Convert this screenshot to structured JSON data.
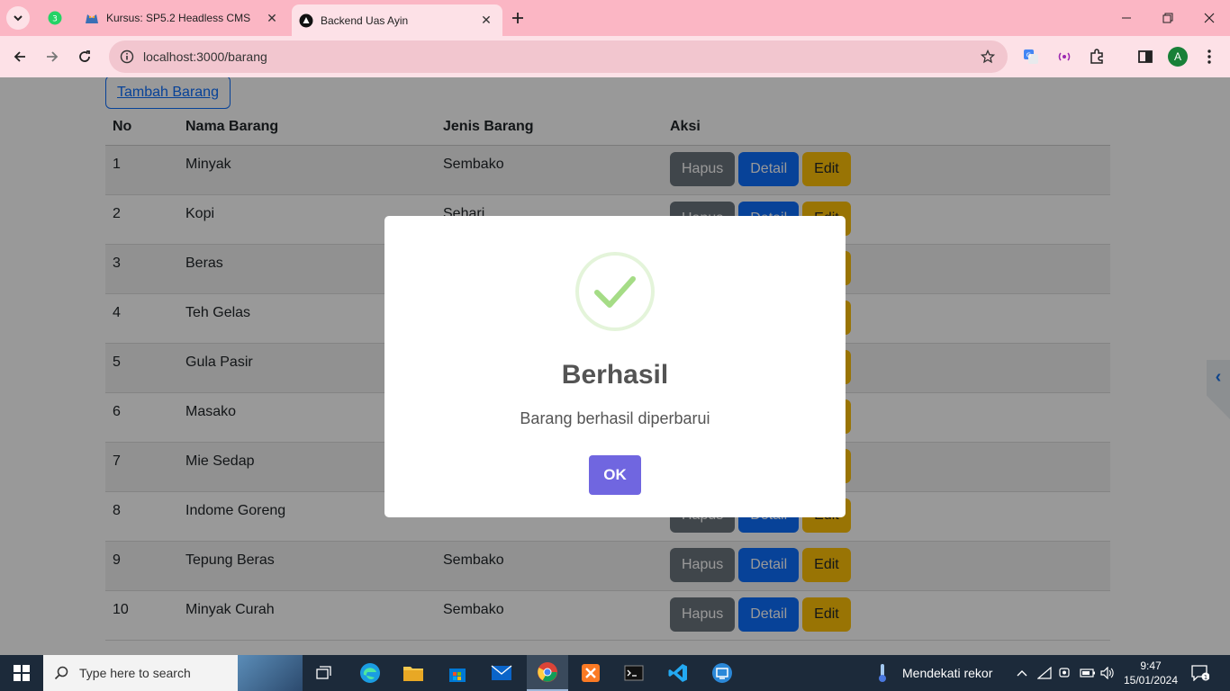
{
  "browser": {
    "pinned_tab_badge": "3",
    "tabs": [
      {
        "title": "Kursus: SP5.2 Headless CMS",
        "active": false
      },
      {
        "title": "Backend Uas Ayin",
        "active": true
      }
    ],
    "url": "localhost:3000/barang",
    "profile_initial": "A"
  },
  "page": {
    "add_button_label": "Tambah Barang",
    "columns": [
      "No",
      "Nama Barang",
      "Jenis Barang",
      "Aksi"
    ],
    "rows": [
      {
        "no": "1",
        "name": "Minyak",
        "type": "Sembako"
      },
      {
        "no": "2",
        "name": "Kopi",
        "type": "Sehari"
      },
      {
        "no": "3",
        "name": "Beras",
        "type": ""
      },
      {
        "no": "4",
        "name": "Teh Gelas",
        "type": ""
      },
      {
        "no": "5",
        "name": "Gula Pasir",
        "type": ""
      },
      {
        "no": "6",
        "name": "Masako",
        "type": ""
      },
      {
        "no": "7",
        "name": "Mie Sedap",
        "type": ""
      },
      {
        "no": "8",
        "name": "Indome Goreng",
        "type": ""
      },
      {
        "no": "9",
        "name": "Tepung Beras",
        "type": "Sembako"
      },
      {
        "no": "10",
        "name": "Minyak Curah",
        "type": "Sembako"
      }
    ],
    "actions": {
      "delete": "Hapus",
      "detail": "Detail",
      "edit": "Edit"
    }
  },
  "dialog": {
    "title": "Berhasil",
    "message": "Barang berhasil diperbarui",
    "confirm_label": "OK"
  },
  "taskbar": {
    "search_placeholder": "Type here to search",
    "weather_text": "Mendekati rekor",
    "time": "9:47",
    "date": "15/01/2024",
    "notification_count": "1"
  },
  "colors": {
    "tabstrip": "#fbb6c4",
    "toolbar": "#fde1e7",
    "primary": "#0d6efd",
    "secondary": "#6c757d",
    "warning": "#ffc107",
    "swal_confirm": "#7066e0",
    "success_check": "#a5dc86"
  }
}
